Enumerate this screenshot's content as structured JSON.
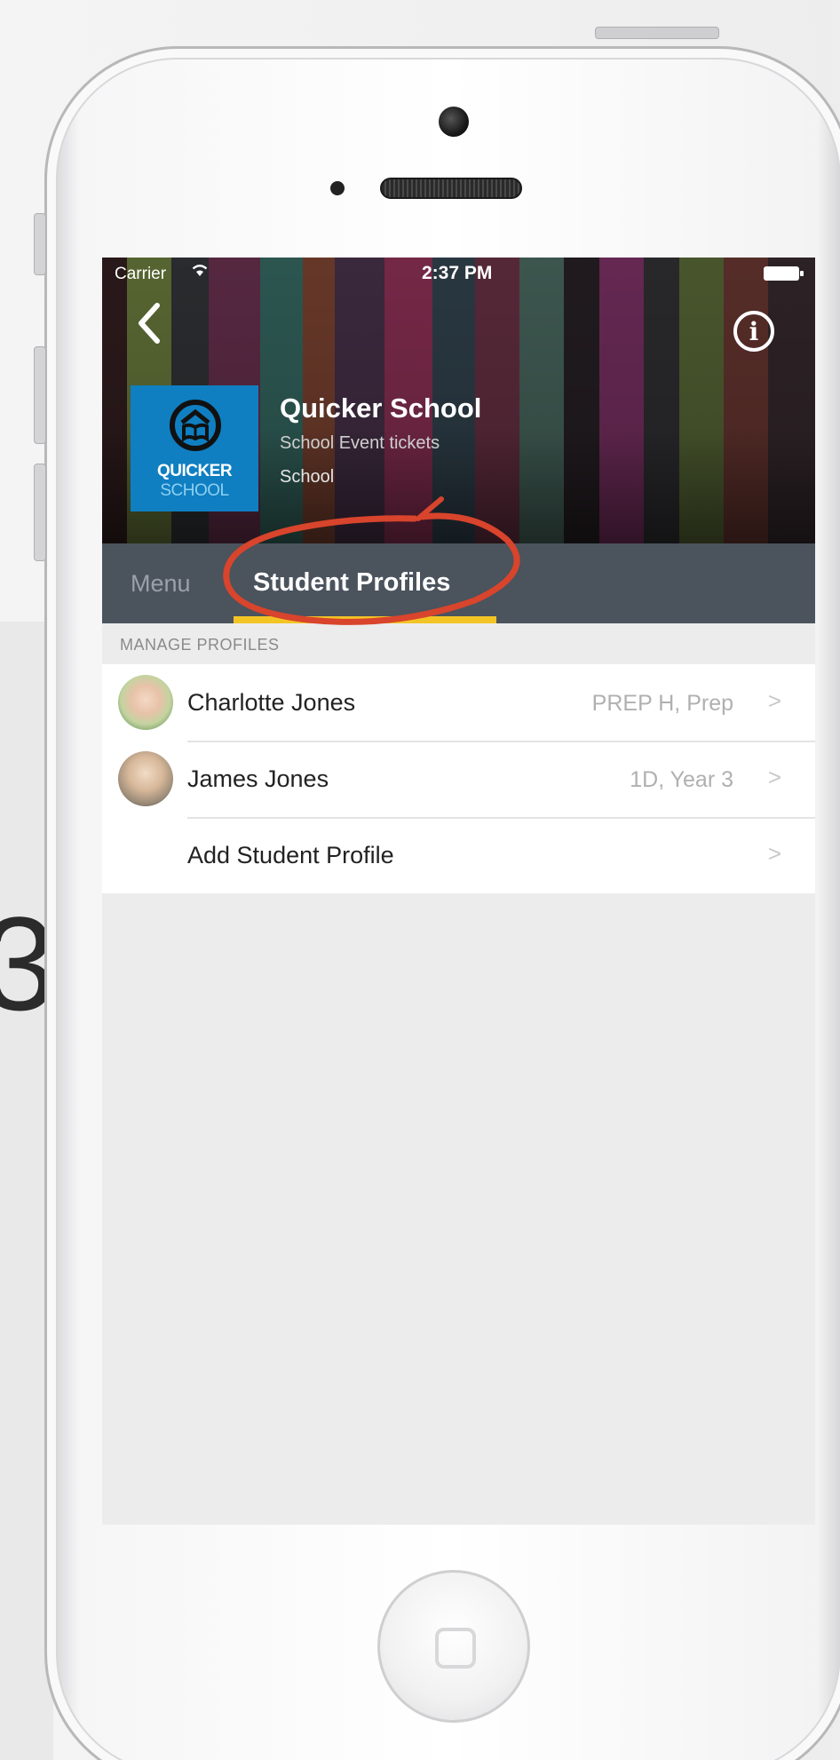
{
  "status_bar": {
    "carrier": "Carrier",
    "time": "2:37 PM"
  },
  "header": {
    "back_icon": "chevron-left-icon",
    "info_icon": "info-circle-icon",
    "info_glyph": "i",
    "logo": {
      "line1": "QUICKER",
      "line2": "SCHOOL"
    },
    "title": "Quicker School",
    "subtitle": "School Event tickets",
    "category": "School"
  },
  "tabs": [
    {
      "label": "Menu",
      "active": false
    },
    {
      "label": "Student Profiles",
      "active": true
    }
  ],
  "section": {
    "header": "MANAGE PROFILES"
  },
  "profiles": [
    {
      "name": "Charlotte  Jones",
      "detail": "PREP H, Prep"
    },
    {
      "name": "James Jones",
      "detail": "1D, Year 3"
    }
  ],
  "add_profile": {
    "label": "Add Student Profile"
  },
  "chevron_glyph": ">",
  "page_glyph": "3",
  "colors": {
    "tab_bar": "#4b535d",
    "tab_indicator": "#f3c425",
    "logo_bg": "#0f7fc2",
    "annotation": "#d8442c"
  }
}
